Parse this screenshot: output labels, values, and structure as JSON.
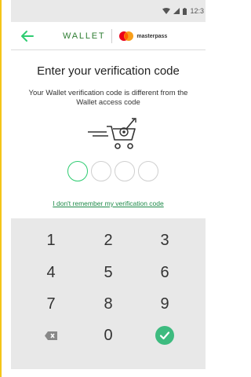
{
  "status_bar": {
    "time": "12:3",
    "icons": [
      "wifi-icon",
      "signal-icon",
      "battery-icon"
    ]
  },
  "header": {
    "brand_text": "WALLET",
    "partner_text": "masterpass",
    "back_icon": "back-arrow-icon"
  },
  "main": {
    "title": "Enter your verification code",
    "subtitle": "Your Wallet verification code is different from the Wallet access code",
    "illustration_icon": "shopping-cart-fast-icon",
    "code_length": 4,
    "code_entered": 0,
    "forgot_link": "I don't remember my verification code"
  },
  "keypad": {
    "keys": [
      "1",
      "2",
      "3",
      "4",
      "5",
      "6",
      "7",
      "8",
      "9",
      "",
      "0",
      ""
    ],
    "delete_icon": "backspace-icon",
    "confirm_icon": "check-icon"
  },
  "colors": {
    "accent": "#2ecc71",
    "brand_green": "#2e7d32",
    "link": "#1e8a49",
    "keypad_bg": "#e8e8e8",
    "frame": "#f5c518"
  }
}
